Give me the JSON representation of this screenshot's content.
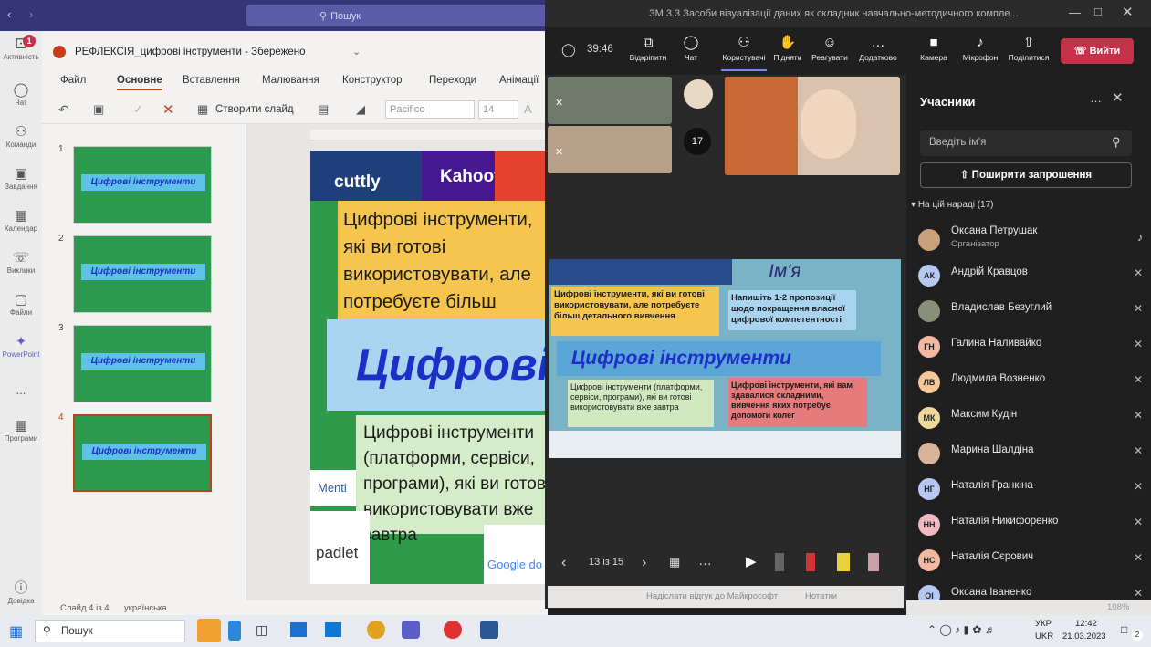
{
  "topbar": {
    "search_placeholder": "Пошук"
  },
  "rail": {
    "items": [
      {
        "label": "Активність",
        "badge": "1"
      },
      {
        "label": "Чат"
      },
      {
        "label": "Команди"
      },
      {
        "label": "Завдання"
      },
      {
        "label": "Календар"
      },
      {
        "label": "Виклики"
      },
      {
        "label": "Файли"
      },
      {
        "label": "PowerPoint"
      },
      {
        "label": "..."
      },
      {
        "label": "Програми"
      },
      {
        "label": "Довідка"
      }
    ]
  },
  "ppt": {
    "file_title": "РЕФЛЕКСІЯ_цифрові інструменти - Збережено",
    "tabs": [
      "Файл",
      "Основне",
      "Вставлення",
      "Малювання",
      "Конструктор",
      "Переходи",
      "Анімації"
    ],
    "new_slide": "Створити слайд",
    "font_name": "Pacifico",
    "font_size": "14",
    "thumb_numbers": [
      "1",
      "2",
      "3",
      "4"
    ],
    "thumb_title": "Цифрові інструменти",
    "slide": {
      "box1": "Цифрові інструменти, які ви готові використовувати, але потребуєте більш детального вивчення",
      "big_title": "Цифрові інструменти",
      "box2": "Цифрові інструменти (платформи, сервіси, програми), які ви готові використовувати вже завтра",
      "logo_cuttly": "cuttly",
      "logo_kahoot": "Kahoot!",
      "logo_menti": "Menti",
      "logo_padlet": "padlet",
      "logo_google": "Google do"
    },
    "status_slide": "Слайд 4 із 4",
    "status_lang": "українська"
  },
  "teams": {
    "title": "ЗМ 3.3 Засоби візуалізації даних як складник навчально-методичного компле...",
    "timer": "39:46",
    "toolbar": [
      "Відкріпити",
      "Чат",
      "Користувачі",
      "Підняти",
      "Реагувати",
      "Додатково",
      "Камера",
      "Мікрофон",
      "Поділитися"
    ],
    "leave": "Вийти",
    "others_count": "17",
    "panel": {
      "title": "Учасники",
      "search_placeholder": "Введіть ім'я",
      "invite": "Поширити запрошення",
      "section": "На цій нараді (17)"
    },
    "participants": [
      {
        "initials": "",
        "name": "Оксана Петрушак",
        "role": "Організатор",
        "color": "#c8a07a"
      },
      {
        "initials": "АК",
        "name": "Андрій Кравцов",
        "color": "#b6c8f0"
      },
      {
        "initials": "",
        "name": "Владислав Безуглий",
        "color": "#8a8f7a"
      },
      {
        "initials": "ГН",
        "name": "Галина Наливайко",
        "color": "#f2b8a0"
      },
      {
        "initials": "ЛВ",
        "name": "Людмила Возненко",
        "color": "#f5c89a"
      },
      {
        "initials": "МК",
        "name": "Максим Кудін",
        "color": "#f0d79a"
      },
      {
        "initials": "",
        "name": "Марина Шалдіна",
        "color": "#d9b49a"
      },
      {
        "initials": "НГ",
        "name": "Наталія Гранкіна",
        "color": "#b6c8f0"
      },
      {
        "initials": "НН",
        "name": "Наталія Никифоренко",
        "color": "#f0b8c0"
      },
      {
        "initials": "НС",
        "name": "Наталія Сєрович",
        "color": "#f2b8a0"
      },
      {
        "initials": "ОІ",
        "name": "Оксана Іваненко",
        "color": "#b6c8f0"
      }
    ],
    "shared": {
      "name_label": "Ім'я",
      "box_a": "Цифрові інструменти, які ви готові використовувати, але потребуєте більш детального вивчення",
      "box_b": "Напишіть 1-2 пропозиції щодо покращення власної цифрової компетентності",
      "title": "Цифрові інструменти",
      "box_c": "Цифрові інструменти (платформи, сервіси, програми), які ви готові використовувати вже завтра",
      "box_d": "Цифрові інструменти, які вам здавалися складними, вивчення яких потребує допомоги колег"
    },
    "pager": "13 із 15",
    "feedback": "Надіслати відгук до Майкрософт",
    "notes": "Нотатки",
    "zoom": "108%"
  },
  "taskbar": {
    "search": "Пошук",
    "lang1": "УКР",
    "lang2": "UKR",
    "time": "12:42",
    "date": "21.03.2023",
    "notif": "2"
  }
}
